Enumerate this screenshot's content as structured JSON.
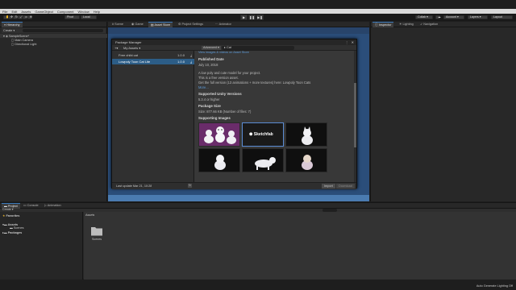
{
  "menubar": [
    "File",
    "Edit",
    "Assets",
    "GameObject",
    "Component",
    "Window",
    "Help"
  ],
  "toolbar": {
    "left_buttons": [
      "Pivot",
      "Local"
    ],
    "play_icons": [
      "play-icon",
      "pause-icon",
      "step-icon"
    ],
    "right_buttons": [
      "Collab ▾",
      "Account ▾",
      "Layers ▾",
      "Layout"
    ]
  },
  "hierarchy": {
    "tab": "Hierarchy",
    "create_label": "Create ▾",
    "scene_name": "SampleScene*",
    "objects": [
      "Main Camera",
      "Directional Light"
    ]
  },
  "center_tabs": [
    "Scene",
    "Game",
    "Asset Store",
    "Project Settings",
    "Animator"
  ],
  "inspector_tabs": [
    "Inspector",
    "Lighting",
    "Navigation"
  ],
  "package_manager": {
    "title": "Package Manager",
    "filter_label": "My Assets ▾",
    "advanced_label": "Advanced ▾",
    "search_value": "▸ Cat",
    "packages": [
      {
        "name": "Free chibi cat",
        "version": "1.0.0",
        "selected": false
      },
      {
        "name": "Lowpoly Toon Cat Lite",
        "version": "1.0.0",
        "selected": true
      }
    ],
    "detail": {
      "top_link": "View images & videos on Asset Store",
      "published_head": "Published Date",
      "published_value": "July 10, 2018",
      "description": [
        "A low poly and cute model for your project.",
        "This is a free version asset.",
        "Get the full version (13 animations + more textures) here: Lowpoly Toon Cats"
      ],
      "more_link": "More...",
      "unity_head": "Supported Unity Versions",
      "unity_value": "5.3.4 or higher",
      "size_head": "Package Size",
      "size_value": "Size: 877.66 KB (Number of files: 7)",
      "images_head": "Supporting Images",
      "sketchfab_label": "Sketchfab"
    },
    "footer_update": "Last update Mar 21, 10:28",
    "import_label": "Import",
    "download_label": "Download"
  },
  "project": {
    "tabs": [
      "Project",
      "Console",
      "Animation"
    ],
    "create_label": "Create ▾",
    "favorites_label": "Favorites",
    "assets_label": "Assets",
    "scenes_label": "Scenes",
    "packages_label": "Packages",
    "breadcrumb": "Assets",
    "folder_label": "Scenes"
  },
  "status": {
    "text": "Auto Generate Lighting Off"
  },
  "colors": {
    "selection": "#2c5d87",
    "link": "#5d9bd9",
    "scene_bg": "#2b4e7a"
  }
}
